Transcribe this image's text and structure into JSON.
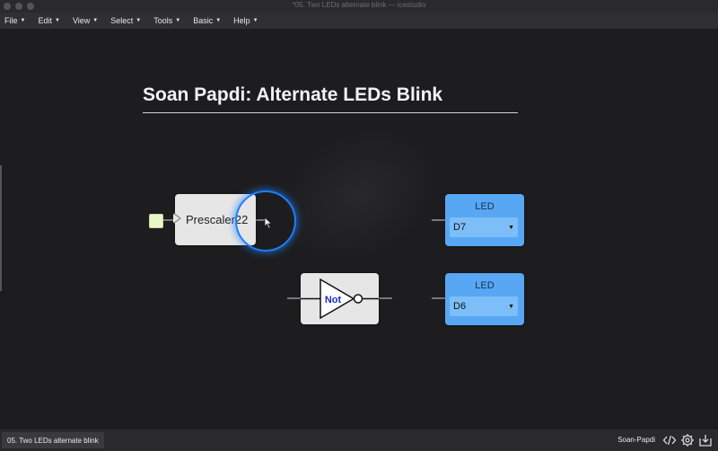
{
  "window": {
    "title": "*05. Two LEDs alternate blink — icestudio"
  },
  "menu": {
    "items": [
      {
        "label": "File"
      },
      {
        "label": "Edit"
      },
      {
        "label": "View"
      },
      {
        "label": "Select"
      },
      {
        "label": "Tools"
      },
      {
        "label": "Basic"
      },
      {
        "label": "Help"
      }
    ]
  },
  "canvas": {
    "heading": "Soan Papdi: Alternate LEDs Blink",
    "prescaler": {
      "label": "Prescaler22"
    },
    "not_gate": {
      "label": "Not"
    },
    "leds": [
      {
        "title": "LED",
        "pin": "D7"
      },
      {
        "title": "LED",
        "pin": "D6"
      }
    ]
  },
  "bottom": {
    "file_tab": "05. Two LEDs alternate blink",
    "project": "Soan-Papdi"
  },
  "colors": {
    "led_block": "#57a7f4",
    "highlight": "#1e7fff",
    "input_pin": "#e9f7c6"
  },
  "icons": [
    "code-icon",
    "collection-gear-icon",
    "export-icon"
  ]
}
